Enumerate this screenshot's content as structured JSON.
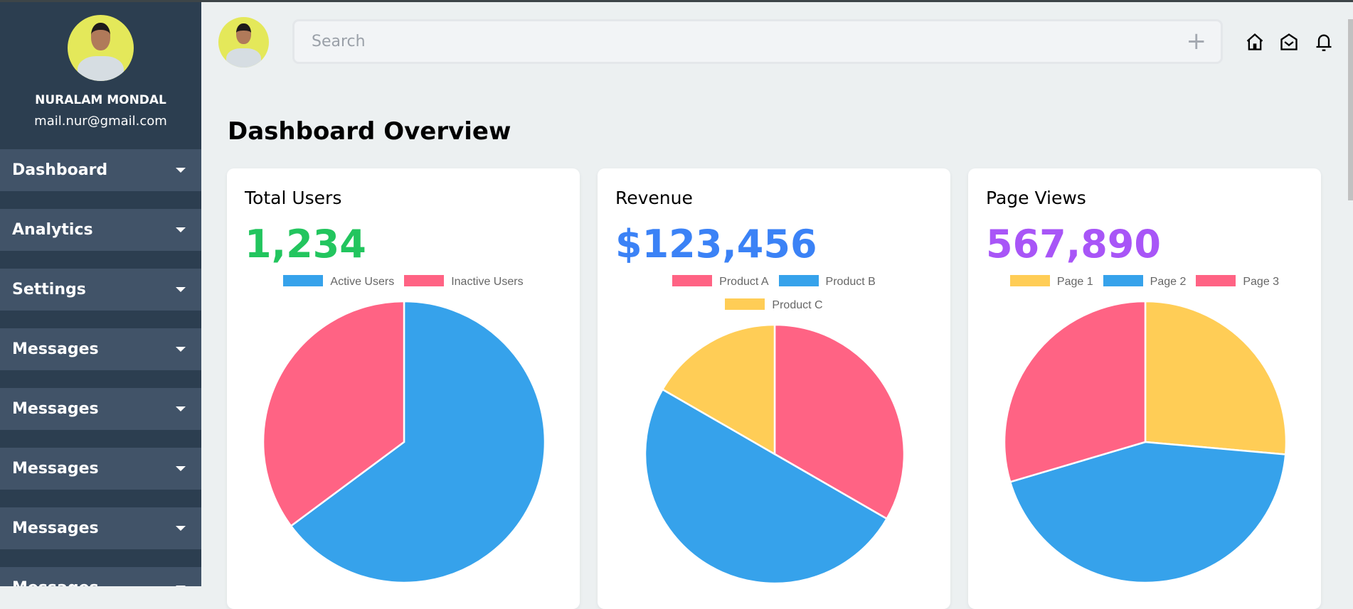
{
  "user": {
    "name": "NURALAM MONDAL",
    "email": "mail.nur@gmail.com"
  },
  "sidebar": {
    "items": [
      {
        "label": "Dashboard"
      },
      {
        "label": "Analytics"
      },
      {
        "label": "Settings"
      },
      {
        "label": "Messages"
      },
      {
        "label": "Messages"
      },
      {
        "label": "Messages"
      },
      {
        "label": "Messages"
      },
      {
        "label": "Messages"
      }
    ]
  },
  "search": {
    "placeholder": "Search"
  },
  "header": {
    "icons": [
      "home-icon",
      "mail-open-icon",
      "bell-icon"
    ]
  },
  "page": {
    "title": "Dashboard Overview"
  },
  "colors": {
    "blue": "#36a2eb",
    "red": "#ff6384",
    "yellow": "#ffcd56"
  },
  "cards": [
    {
      "title": "Total Users",
      "value": "1,234",
      "value_color": "#22c55e"
    },
    {
      "title": "Revenue",
      "value": "$123,456",
      "value_color": "#3b82f6"
    },
    {
      "title": "Page Views",
      "value": "567,890",
      "value_color": "#a855f7"
    }
  ],
  "chart_data": [
    {
      "type": "pie",
      "title": "Total Users",
      "labels": [
        "Active Users",
        "Inactive Users"
      ],
      "values": [
        800,
        434
      ],
      "colors": [
        "#36a2eb",
        "#ff6384"
      ],
      "legend": "top"
    },
    {
      "type": "pie",
      "title": "Revenue",
      "labels": [
        "Product A",
        "Product B",
        "Product C"
      ],
      "values": [
        41152,
        61728,
        20576
      ],
      "colors": [
        "#ff6384",
        "#36a2eb",
        "#ffcd56"
      ],
      "legend": "top"
    },
    {
      "type": "pie",
      "title": "Page Views",
      "labels": [
        "Page 1",
        "Page 2",
        "Page 3"
      ],
      "values": [
        150000,
        250000,
        168000
      ],
      "colors": [
        "#ffcd56",
        "#36a2eb",
        "#ff6384"
      ],
      "legend": "top"
    }
  ]
}
